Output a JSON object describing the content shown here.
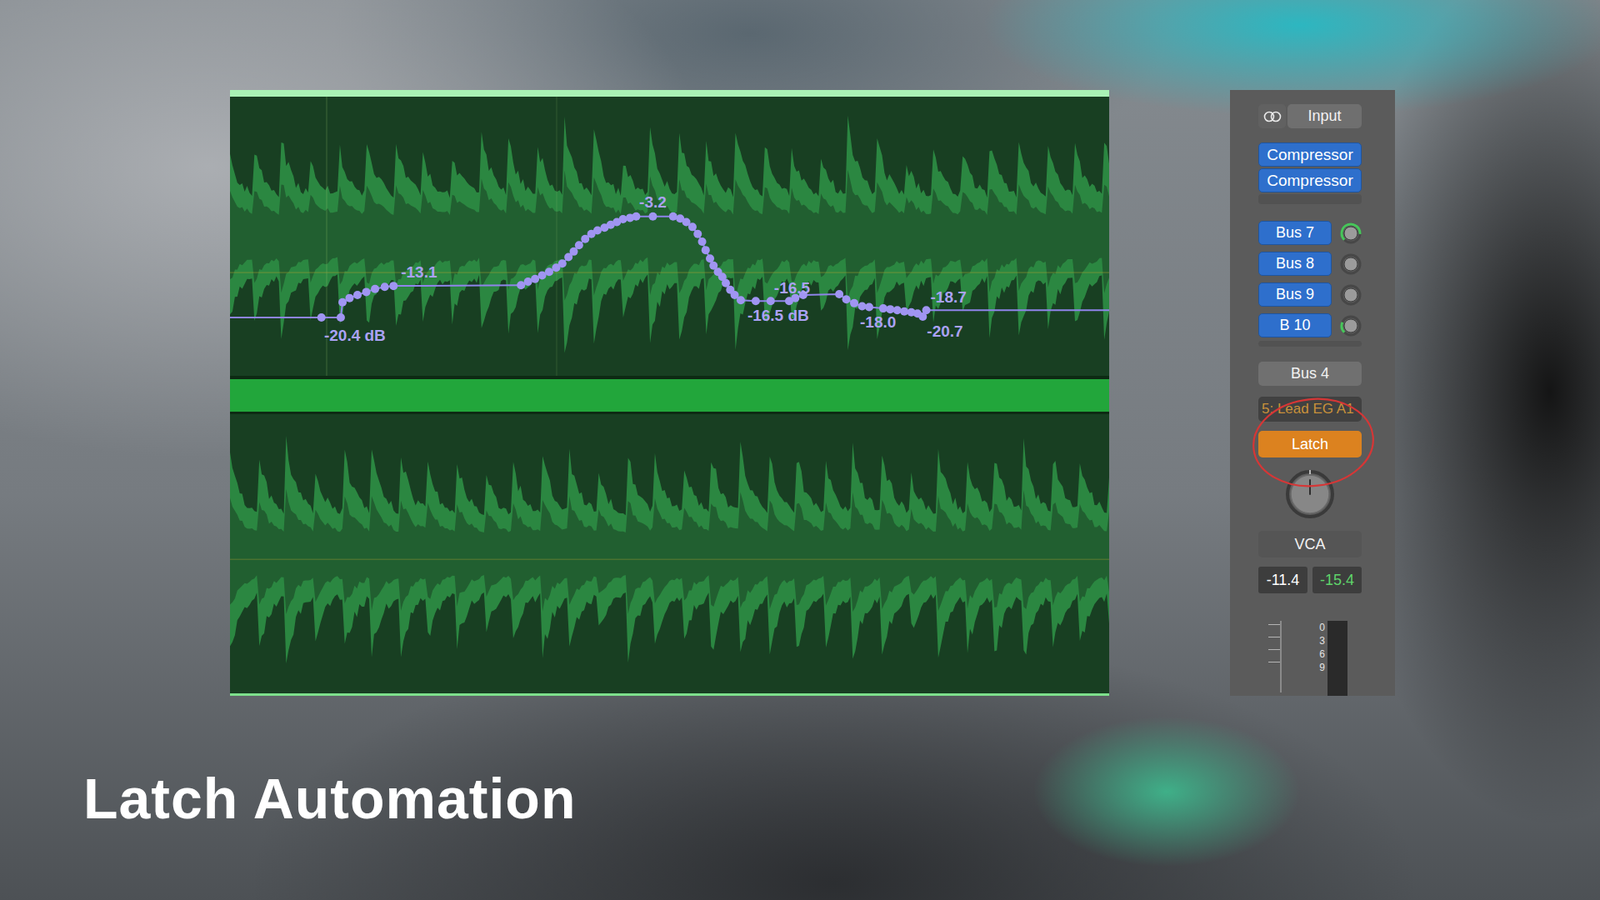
{
  "caption": "Latch Automation",
  "region": {
    "automation": {
      "points": [
        {
          "x": 0.104,
          "db": -20.4
        },
        {
          "x": 0.126,
          "db": -20.4
        },
        {
          "x": 0.128,
          "db": -16.9
        },
        {
          "x": 0.136,
          "db": -15.9
        },
        {
          "x": 0.145,
          "db": -15.2
        },
        {
          "x": 0.155,
          "db": -14.5
        },
        {
          "x": 0.165,
          "db": -13.8
        },
        {
          "x": 0.176,
          "db": -13.3
        },
        {
          "x": 0.186,
          "db": -13.1
        },
        {
          "x": 0.331,
          "db": -13.0
        },
        {
          "x": 0.339,
          "db": -12.5
        },
        {
          "x": 0.347,
          "db": -12.1
        },
        {
          "x": 0.355,
          "db": -11.6
        },
        {
          "x": 0.363,
          "db": -11.1
        },
        {
          "x": 0.371,
          "db": -10.5
        },
        {
          "x": 0.378,
          "db": -9.9
        },
        {
          "x": 0.385,
          "db": -9.0
        },
        {
          "x": 0.391,
          "db": -8.2
        },
        {
          "x": 0.397,
          "db": -7.3
        },
        {
          "x": 0.404,
          "db": -6.4
        },
        {
          "x": 0.411,
          "db": -5.7
        },
        {
          "x": 0.418,
          "db": -5.2
        },
        {
          "x": 0.426,
          "db": -4.8
        },
        {
          "x": 0.433,
          "db": -4.4
        },
        {
          "x": 0.44,
          "db": -4.0
        },
        {
          "x": 0.447,
          "db": -3.6
        },
        {
          "x": 0.455,
          "db": -3.4
        },
        {
          "x": 0.462,
          "db": -3.2
        },
        {
          "x": 0.481,
          "db": -3.2
        },
        {
          "x": 0.504,
          "db": -3.2
        },
        {
          "x": 0.512,
          "db": -3.5
        },
        {
          "x": 0.519,
          "db": -4.0
        },
        {
          "x": 0.526,
          "db": -4.7
        },
        {
          "x": 0.532,
          "db": -5.7
        },
        {
          "x": 0.537,
          "db": -6.8
        },
        {
          "x": 0.541,
          "db": -8.0
        },
        {
          "x": 0.546,
          "db": -9.2
        },
        {
          "x": 0.55,
          "db": -10.2
        },
        {
          "x": 0.555,
          "db": -11.1
        },
        {
          "x": 0.56,
          "db": -11.8
        },
        {
          "x": 0.564,
          "db": -12.7
        },
        {
          "x": 0.569,
          "db": -14.0
        },
        {
          "x": 0.574,
          "db": -15.2
        },
        {
          "x": 0.581,
          "db": -16.4
        },
        {
          "x": 0.598,
          "db": -16.6
        },
        {
          "x": 0.615,
          "db": -16.6
        },
        {
          "x": 0.636,
          "db": -16.6
        },
        {
          "x": 0.643,
          "db": -15.9
        },
        {
          "x": 0.652,
          "db": -15.2
        },
        {
          "x": 0.693,
          "db": -15.0
        },
        {
          "x": 0.701,
          "db": -16.2
        },
        {
          "x": 0.71,
          "db": -17.1
        },
        {
          "x": 0.719,
          "db": -17.8
        },
        {
          "x": 0.727,
          "db": -18.0
        },
        {
          "x": 0.743,
          "db": -18.3
        },
        {
          "x": 0.751,
          "db": -18.5
        },
        {
          "x": 0.759,
          "db": -18.7
        },
        {
          "x": 0.767,
          "db": -19.0
        },
        {
          "x": 0.775,
          "db": -19.2
        },
        {
          "x": 0.782,
          "db": -19.5
        },
        {
          "x": 0.788,
          "db": -20.2
        },
        {
          "x": 0.792,
          "db": -18.7
        }
      ],
      "labels": [
        {
          "text": "-20.4 dB",
          "point": 1
        },
        {
          "text": "-13.1",
          "point": 8
        },
        {
          "text": "-3.2",
          "point": 28
        },
        {
          "text": "-16.5",
          "point": 45
        },
        {
          "text": "-16.5 dB",
          "point": 44
        },
        {
          "text": "-18.0",
          "point": 53
        },
        {
          "text": "-18.7",
          "point": 61
        },
        {
          "text": "-20.7",
          "point": 60
        }
      ]
    }
  },
  "channel_strip": {
    "input": "Input",
    "plugins": [
      {
        "label": "Compressor"
      },
      {
        "label": "Compressor"
      }
    ],
    "sends": [
      {
        "label": "Bus 7",
        "level": 0.85
      },
      {
        "label": "Bus 8",
        "level": 0
      },
      {
        "label": "Bus 9",
        "level": 0
      },
      {
        "label": "B 10",
        "level": 0.25
      }
    ],
    "output": "Bus 4",
    "track_name": "5: Lead EG A1",
    "automation_mode": {
      "label": "Latch",
      "annotated": true
    },
    "pan": {
      "level": 0.5
    },
    "group": "VCA",
    "readouts": [
      {
        "text": "-11.4",
        "color": "#ffffff"
      },
      {
        "text": "-15.4",
        "color": "#5fd36a"
      }
    ],
    "meter": {
      "scale": [
        "0",
        "3",
        "6",
        "9"
      ],
      "level": 0
    }
  }
}
